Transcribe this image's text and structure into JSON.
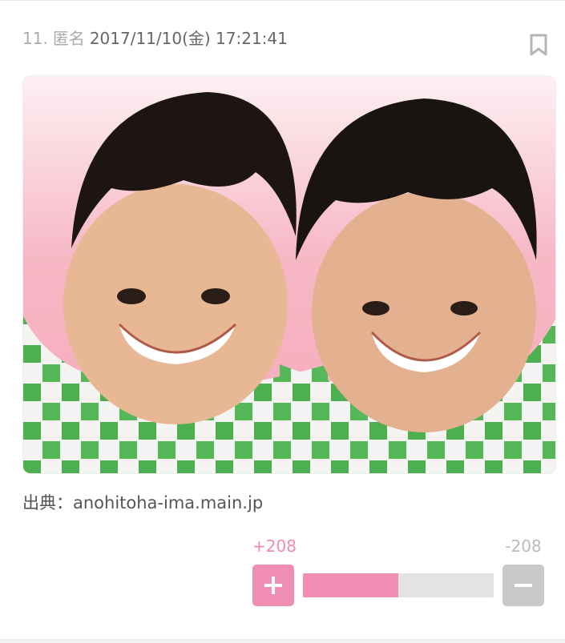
{
  "post": {
    "number": "11.",
    "author": "匿名",
    "datetime": "2017/11/10(金) 17:21:41",
    "source_text": "出典：anohitoha-ima.main.jp"
  },
  "photo": {
    "subject": "two-smiling-men-portrait"
  },
  "votes": {
    "plus_label": "+208",
    "minus_label": "-208",
    "plus_fraction": 0.5
  },
  "colors": {
    "accent": "#f08db2",
    "plus_text": "#f28bb0",
    "neutral": "#c9c9c9"
  },
  "icons": {
    "bookmark": "bookmark-icon",
    "plus": "plus-icon",
    "minus": "minus-icon"
  }
}
